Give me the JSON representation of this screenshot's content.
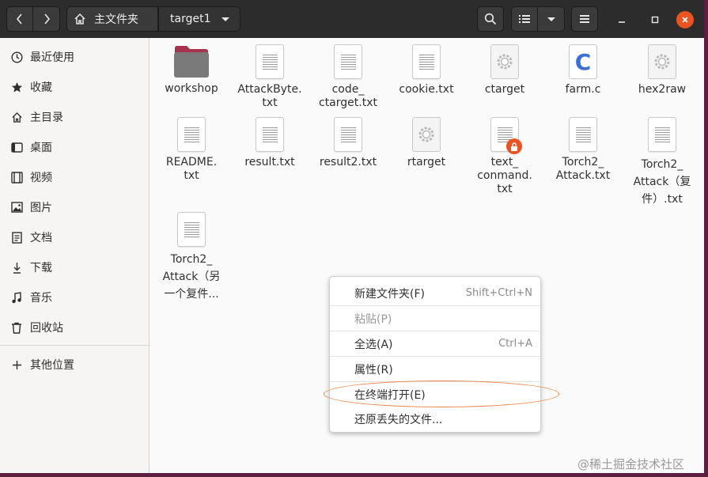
{
  "header": {
    "breadcrumb_home": "主文件夹",
    "breadcrumb_current": "target1"
  },
  "sidebar": {
    "items": [
      {
        "label": "最近使用",
        "icon": "clock-icon"
      },
      {
        "label": "收藏",
        "icon": "star-icon"
      },
      {
        "label": "主目录",
        "icon": "home-icon"
      },
      {
        "label": "桌面",
        "icon": "desktop-icon"
      },
      {
        "label": "视频",
        "icon": "film-icon"
      },
      {
        "label": "图片",
        "icon": "picture-icon"
      },
      {
        "label": "文档",
        "icon": "document-icon"
      },
      {
        "label": "下载",
        "icon": "download-icon"
      },
      {
        "label": "音乐",
        "icon": "music-icon"
      },
      {
        "label": "回收站",
        "icon": "trash-icon"
      },
      {
        "label": "其他位置",
        "icon": "plus-icon"
      }
    ]
  },
  "files": [
    {
      "name": "workshop",
      "type": "folder"
    },
    {
      "name": "AttackByte.\ntxt",
      "type": "text"
    },
    {
      "name": "code_\nctarget.txt",
      "type": "text"
    },
    {
      "name": "cookie.txt",
      "type": "text"
    },
    {
      "name": "ctarget",
      "type": "executable"
    },
    {
      "name": "farm.c",
      "type": "c-source"
    },
    {
      "name": "hex2raw",
      "type": "executable"
    },
    {
      "name": "README.\ntxt",
      "type": "text"
    },
    {
      "name": "result.txt",
      "type": "text"
    },
    {
      "name": "result2.txt",
      "type": "text"
    },
    {
      "name": "rtarget",
      "type": "executable"
    },
    {
      "name": "text_\nconmand.\ntxt",
      "type": "text-locked"
    },
    {
      "name": "Torch2_\nAttack.txt",
      "type": "text"
    },
    {
      "name": "Torch2_\nAttack（复\n件）.txt",
      "type": "text"
    },
    {
      "name": "Torch2_\nAttack（另\n一个复件...",
      "type": "text"
    }
  ],
  "context_menu": {
    "items": [
      {
        "label": "新建文件夹(F)",
        "accel": "Shift+Ctrl+N",
        "enabled": true
      },
      {
        "label": "粘贴(P)",
        "accel": "",
        "enabled": false
      },
      {
        "label": "全选(A)",
        "accel": "Ctrl+A",
        "enabled": true
      },
      {
        "label": "属性(R)",
        "accel": "",
        "enabled": true
      },
      {
        "label": "在终端打开(E)",
        "accel": "",
        "enabled": true,
        "highlighted_by_annotation": true
      },
      {
        "label": "还原丢失的文件...",
        "accel": "",
        "enabled": true
      }
    ]
  },
  "watermark": "@稀土掘金技术社区",
  "colors": {
    "headerbar": "#2c2c2c",
    "accent_orange": "#e95420",
    "annotation_ellipse": "#e9844a",
    "folder": "#7a7a7a",
    "folder_tab": "#a5334f"
  }
}
